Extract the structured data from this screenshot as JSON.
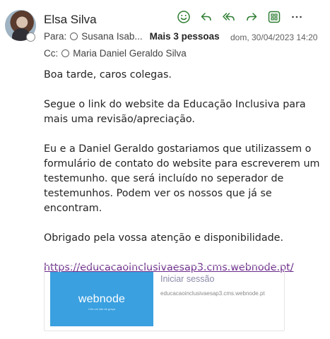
{
  "message": {
    "sender": "Elsa Silva",
    "to_label": "Para:",
    "to_first": "Susana Isab...",
    "to_more": "Mais 3 pessoas",
    "date": "dom, 30/04/2023 14:20",
    "cc_label": "Cc:",
    "cc_first": "Maria Daniel Geraldo Silva"
  },
  "actions": {
    "icons": [
      "smiley-icon",
      "reply-icon",
      "reply-all-icon",
      "forward-icon",
      "apps-icon",
      "more-icon"
    ]
  },
  "body": {
    "greeting": "Boa tarde, caros colegas.",
    "p1": "Segue o link do website da Educação Inclusiva para mais uma revisão/apreciação.",
    "p2": "Eu e a Daniel Geraldo gostariamos que utilizassem o formulário de contato do website para escreverem um testemunho. que será incluído no seperador de testemunhos. Podem ver os nossos que já se encontram.",
    "p3": "Obrigado pela vossa atenção e disponibilidade.",
    "link": "https://educacaoinclusivaesap3.cms.webnode.pt/"
  },
  "preview": {
    "logo_text": "webnode",
    "logo_tagline": "Crie um site de graça",
    "title": "Iniciar sessão",
    "url": "educacaoinclusivaesap3.cms.webnode.pt",
    "thumb_color": "#3aa0e0"
  },
  "colors": {
    "accent": "#2e7d32",
    "link": "#6b2a8a"
  }
}
